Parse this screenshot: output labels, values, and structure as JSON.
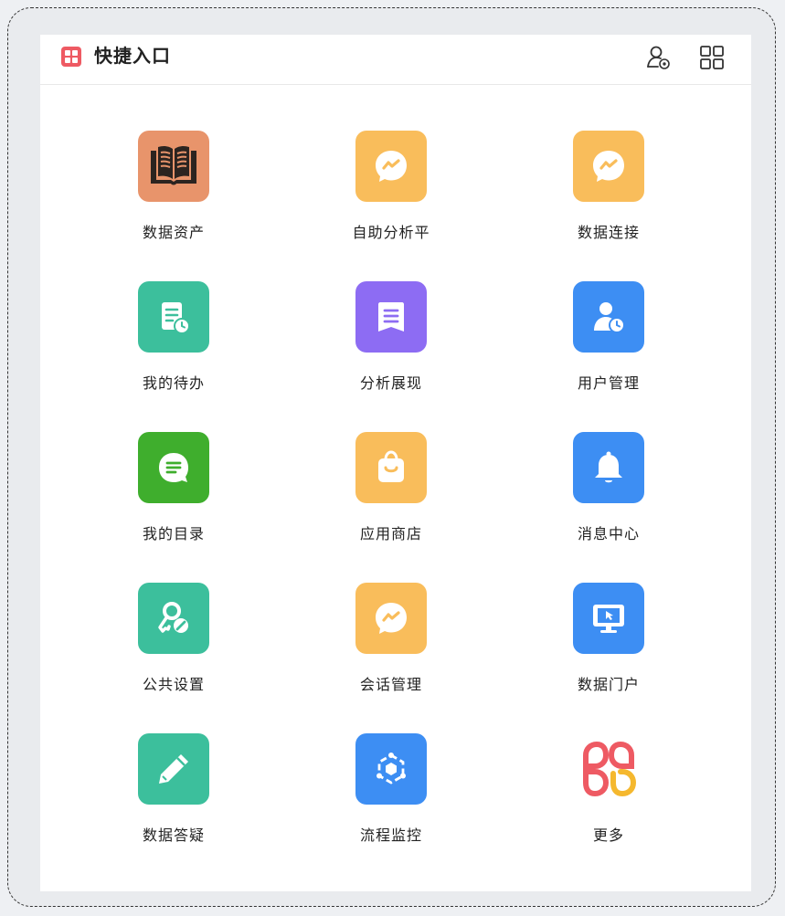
{
  "header": {
    "title": "快捷入口",
    "icons": [
      "apps-logo-icon",
      "user-settings-icon",
      "grid-layout-icon"
    ]
  },
  "items": [
    {
      "label": "数据资产",
      "icon": "book-icon",
      "color": "#e8946b"
    },
    {
      "label": "自助分析平",
      "icon": "chart-bubble-icon",
      "color": "#f9bd5b"
    },
    {
      "label": "数据连接",
      "icon": "chart-bubble-icon",
      "color": "#f9bd5b"
    },
    {
      "label": "我的待办",
      "icon": "task-clock-icon",
      "color": "#3cbf9c"
    },
    {
      "label": "分析展现",
      "icon": "document-list-icon",
      "color": "#8d6cf3"
    },
    {
      "label": "用户管理",
      "icon": "user-clock-icon",
      "color": "#3d8ef3"
    },
    {
      "label": "我的目录",
      "icon": "chat-lines-icon",
      "color": "#3fae2d"
    },
    {
      "label": "应用商店",
      "icon": "shopping-bag-icon",
      "color": "#f9bd5b"
    },
    {
      "label": "消息中心",
      "icon": "bell-icon",
      "color": "#3d8ef3"
    },
    {
      "label": "公共设置",
      "icon": "key-settings-icon",
      "color": "#3cbf9c"
    },
    {
      "label": "会话管理",
      "icon": "chart-bubble-icon",
      "color": "#f9bd5b"
    },
    {
      "label": "数据门户",
      "icon": "monitor-cursor-icon",
      "color": "#3d8ef3"
    },
    {
      "label": "数据答疑",
      "icon": "pencil-icon",
      "color": "#3cbf9c"
    },
    {
      "label": "流程监控",
      "icon": "hexagon-network-icon",
      "color": "#3d8ef3"
    },
    {
      "label": "更多",
      "icon": "more-petals-icon",
      "color": "#ffffff"
    }
  ]
}
